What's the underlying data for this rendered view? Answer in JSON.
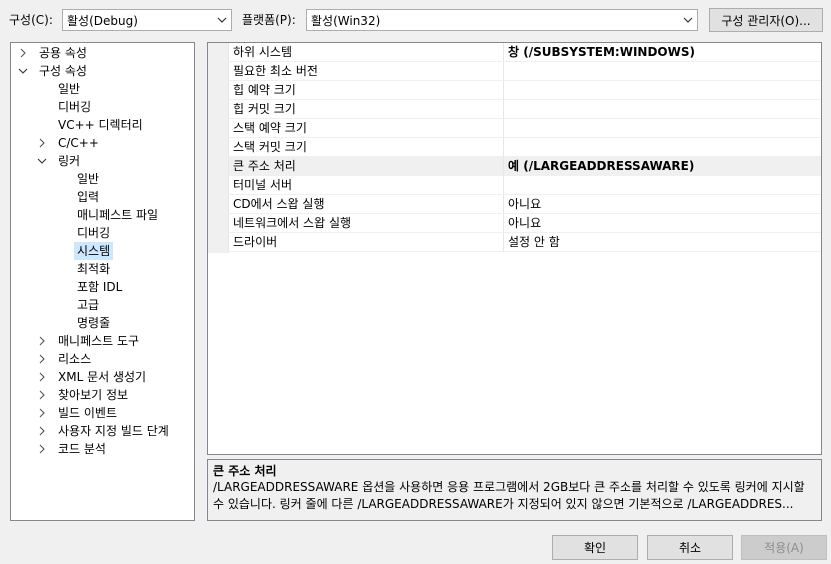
{
  "toolbar": {
    "config_label": "구성(C):",
    "config_value": "활성(Debug)",
    "platform_label": "플랫폼(P):",
    "platform_value": "활성(Win32)",
    "config_manager_button": "구성 관리자(O)..."
  },
  "tree": {
    "items": [
      {
        "label": "공용 속성",
        "expander": "collapsed"
      },
      {
        "label": "구성 속성",
        "expander": "expanded"
      },
      {
        "label": "일반",
        "expander": "none"
      },
      {
        "label": "디버깅",
        "expander": "none"
      },
      {
        "label": "VC++ 디렉터리",
        "expander": "none"
      },
      {
        "label": "C/C++",
        "expander": "collapsed"
      },
      {
        "label": "링커",
        "expander": "expanded"
      },
      {
        "label": "일반",
        "expander": "none"
      },
      {
        "label": "입력",
        "expander": "none"
      },
      {
        "label": "매니페스트 파일",
        "expander": "none"
      },
      {
        "label": "디버깅",
        "expander": "none"
      },
      {
        "label": "시스템",
        "expander": "none",
        "selected": true
      },
      {
        "label": "최적화",
        "expander": "none"
      },
      {
        "label": "포함 IDL",
        "expander": "none"
      },
      {
        "label": "고급",
        "expander": "none"
      },
      {
        "label": "명령줄",
        "expander": "none"
      },
      {
        "label": "매니페스트 도구",
        "expander": "collapsed"
      },
      {
        "label": "리소스",
        "expander": "collapsed"
      },
      {
        "label": "XML 문서 생성기",
        "expander": "collapsed"
      },
      {
        "label": "찾아보기 정보",
        "expander": "collapsed"
      },
      {
        "label": "빌드 이벤트",
        "expander": "collapsed"
      },
      {
        "label": "사용자 지정 빌드 단계",
        "expander": "collapsed"
      },
      {
        "label": "코드 분석",
        "expander": "collapsed"
      }
    ]
  },
  "grid": {
    "rows": [
      {
        "name": "하위 시스템",
        "value": "창 (/SUBSYSTEM:WINDOWS)",
        "bold": true
      },
      {
        "name": "필요한 최소 버전",
        "value": ""
      },
      {
        "name": "힙 예약 크기",
        "value": ""
      },
      {
        "name": "힙 커밋 크기",
        "value": ""
      },
      {
        "name": "스택 예약 크기",
        "value": ""
      },
      {
        "name": "스택 커밋 크기",
        "value": ""
      },
      {
        "name": "큰 주소 처리",
        "value": "예 (/LARGEADDRESSAWARE)",
        "bold": true,
        "highlighted": true
      },
      {
        "name": "터미널 서버",
        "value": ""
      },
      {
        "name": "CD에서 스왑 실행",
        "value": "아니요"
      },
      {
        "name": "네트워크에서 스왑 실행",
        "value": "아니요"
      },
      {
        "name": "드라이버",
        "value": "설정 안 함"
      }
    ]
  },
  "description": {
    "title": "큰 주소 처리",
    "body": "/LARGEADDRESSAWARE 옵션을 사용하면 응용 프로그램에서 2GB보다 큰 주소를 처리할 수 있도록 링커에 지시할 수 있습니다. 링커 줄에 다른 /LARGEADDRESSAWARE가 지정되어 있지 않으면 기본적으로 /LARGEADDRES..."
  },
  "footer": {
    "ok": "확인",
    "cancel": "취소",
    "apply": "적용(A)"
  },
  "icons": {
    "collapsed": "chevron-right-icon",
    "expanded": "chevron-down-icon",
    "dropdown": "chevron-down-icon"
  }
}
